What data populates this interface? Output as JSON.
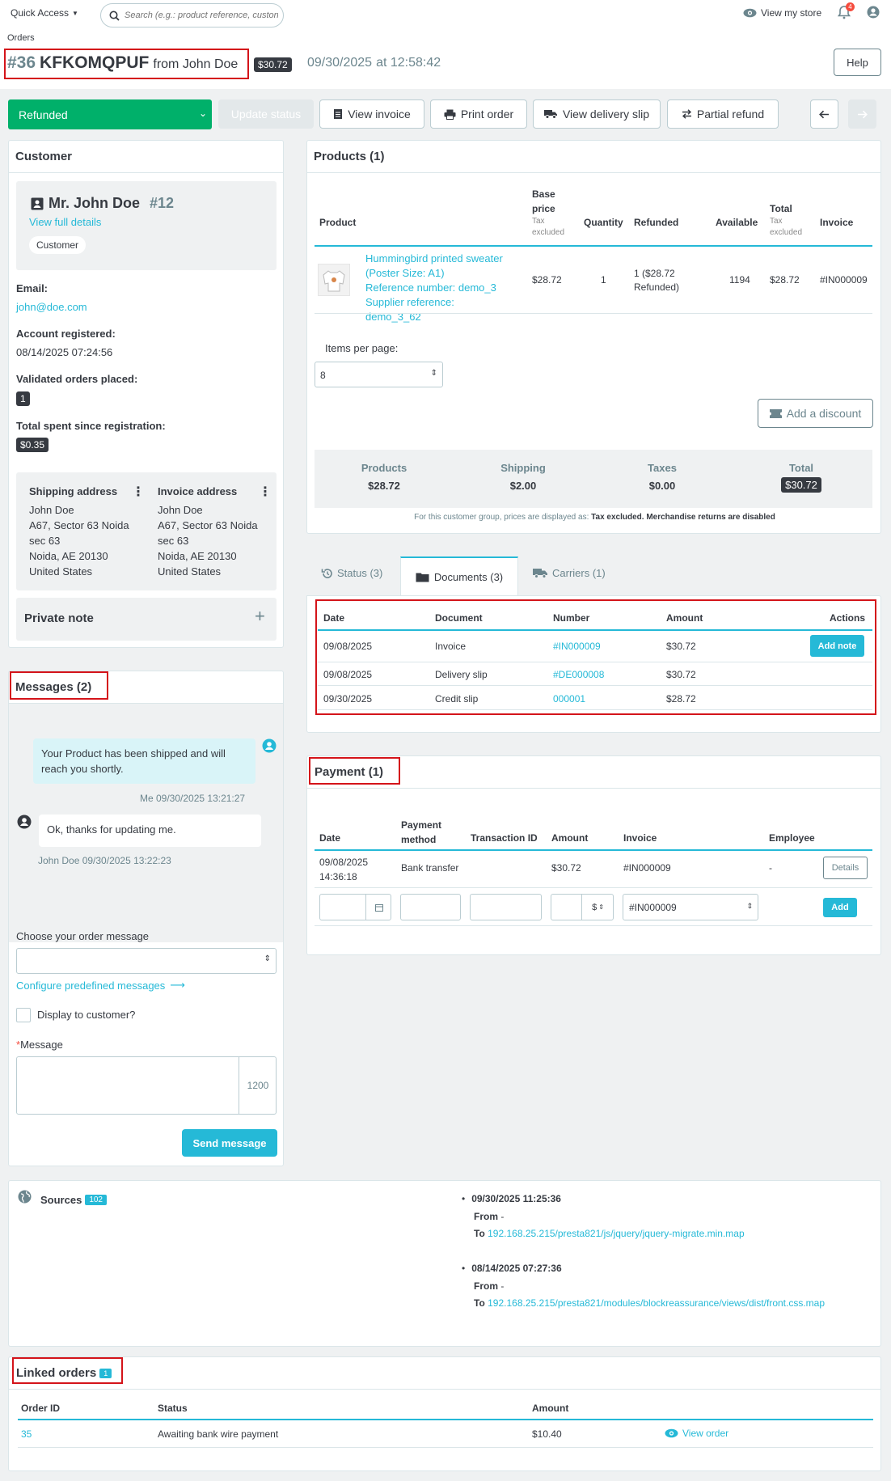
{
  "header": {
    "quick_access": "Quick Access",
    "search_placeholder": "Search (e.g.: product reference, custon",
    "view_store": "View my store",
    "notif_count": "4",
    "breadcrumb": "Orders",
    "order_num": "#36",
    "order_ref": "KFKOMQPUF",
    "from": "from John Doe",
    "total_badge": "$30.72",
    "date": "09/30/2025",
    "at": "at 12:58:42",
    "help": "Help"
  },
  "toolbar": {
    "status": "Refunded",
    "update": "Update status",
    "view_invoice": "View invoice",
    "print": "Print order",
    "delivery": "View delivery slip",
    "partial_refund": "Partial refund"
  },
  "customer": {
    "title": "Customer",
    "name": "Mr. John Doe",
    "id": "#12",
    "view_full": "View full details",
    "group": "Customer",
    "email_label": "Email:",
    "email": "john@doe.com",
    "registered_label": "Account registered:",
    "registered": "08/14/2025 07:24:56",
    "orders_label": "Validated orders placed:",
    "orders": "1",
    "spent_label": "Total spent since registration:",
    "spent": "$0.35",
    "ship_title": "Shipping address",
    "inv_title": "Invoice address",
    "ship_lines": [
      "John Doe",
      "A67, Sector 63 Noida",
      "sec 63",
      "Noida, AE 20130",
      "United States"
    ],
    "inv_lines": [
      "John Doe",
      "A67, Sector 63 Noida",
      "sec 63",
      "Noida, AE 20130",
      "United States"
    ],
    "private_note": "Private note"
  },
  "messages": {
    "title": "Messages (2)",
    "m1": "Your Product has been shipped and will reach you shortly.",
    "m1_meta": "Me 09/30/2025 13:21:27",
    "m2": "Ok, thanks for updating me.",
    "m2_meta": "John Doe 09/30/2025 13:22:23",
    "choose": "Choose your order message",
    "configure": "Configure predefined messages",
    "display": "Display to customer?",
    "message_label": "Message",
    "counter": "1200",
    "send": "Send message"
  },
  "products": {
    "title": "Products (1)",
    "headers": {
      "product": "Product",
      "base": "Base price",
      "tax_excl": "Tax excluded",
      "qty": "Quantity",
      "refunded": "Refunded",
      "available": "Available",
      "total": "Total",
      "invoice": "Invoice"
    },
    "row": {
      "name": "Hummingbird printed sweater (Poster Size: A1)",
      "ref": "Reference number: demo_3",
      "supplier": "Supplier reference: demo_3_62",
      "price": "$28.72",
      "qty": "1",
      "refunded": "1 ($28.72 Refunded)",
      "available": "1194",
      "total": "$28.72",
      "invoice": "#IN000009"
    },
    "items_per_page": "Items per page:",
    "per_page_value": "8",
    "add_discount": "Add a discount",
    "sum": {
      "products_l": "Products",
      "products": "$28.72",
      "shipping_l": "Shipping",
      "shipping": "$2.00",
      "taxes_l": "Taxes",
      "taxes": "$0.00",
      "total_l": "Total",
      "total": "$30.72"
    },
    "note_a": "For this customer group, prices are displayed as:",
    "note_b": "Tax excluded.",
    "note_c": "Merchandise returns are disabled"
  },
  "tabs": {
    "status": "Status (3)",
    "documents": "Documents (3)",
    "carriers": "Carriers (1)"
  },
  "documents": {
    "headers": [
      "Date",
      "Document",
      "Number",
      "Amount",
      "Actions"
    ],
    "rows": [
      {
        "date": "09/08/2025",
        "doc": "Invoice",
        "num": "#IN000009",
        "amount": "$30.72",
        "action": "Add note"
      },
      {
        "date": "09/08/2025",
        "doc": "Delivery slip",
        "num": "#DE000008",
        "amount": "$30.72",
        "action": ""
      },
      {
        "date": "09/30/2025",
        "doc": "Credit slip",
        "num": "000001",
        "amount": "$28.72",
        "action": ""
      }
    ]
  },
  "payment": {
    "title": "Payment (1)",
    "headers": {
      "date": "Date",
      "method": "Payment method",
      "tx": "Transaction ID",
      "amount": "Amount",
      "invoice": "Invoice",
      "employee": "Employee"
    },
    "row": {
      "date": "09/08/2025 14:36:18",
      "method": "Bank transfer",
      "tx": "",
      "amount": "$30.72",
      "invoice": "#IN000009",
      "employee": "-",
      "details": "Details"
    },
    "currency": "$",
    "invoice_select": "#IN000009",
    "add": "Add"
  },
  "sources": {
    "title": "Sources",
    "count": "102",
    "entries": [
      {
        "date": "09/30/2025 11:25:36",
        "from": "From",
        "from_val": "-",
        "to": "To",
        "url": "192.168.25.215/presta821/js/jquery/jquery-migrate.min.map"
      },
      {
        "date": "08/14/2025 07:27:36",
        "from": "From",
        "from_val": "-",
        "to": "To",
        "url": "192.168.25.215/presta821/modules/blockreassurance/views/dist/front.css.map"
      }
    ]
  },
  "linked": {
    "title": "Linked orders",
    "count": "1",
    "headers": {
      "id": "Order ID",
      "status": "Status",
      "amount": "Amount"
    },
    "row": {
      "id": "35",
      "status": "Awaiting bank wire payment",
      "amount": "$10.40",
      "view": "View order"
    }
  }
}
